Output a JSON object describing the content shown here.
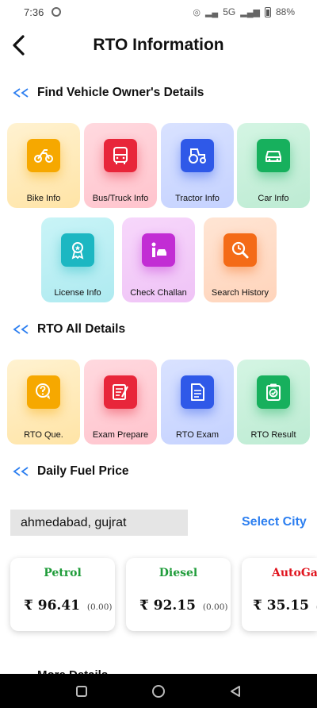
{
  "status_bar": {
    "time": "7:36",
    "network": "5G",
    "battery": "88%"
  },
  "header": {
    "title": "RTO Information"
  },
  "sections": {
    "owner": {
      "title": "Find Vehicle Owner's Details",
      "tiles": [
        {
          "label": "Bike Info",
          "icon": "motorbike-icon",
          "color": "#f6a800"
        },
        {
          "label": "Bus/Truck Info",
          "icon": "bus-icon",
          "color": "#e8263a"
        },
        {
          "label": "Tractor Info",
          "icon": "tractor-icon",
          "color": "#2f59e8"
        },
        {
          "label": "Car Info",
          "icon": "car-icon",
          "color": "#17b05d"
        },
        {
          "label": "License Info",
          "icon": "license-badge-icon",
          "color": "#1cb7c2"
        },
        {
          "label": "Check Challan",
          "icon": "challan-icon",
          "color": "#c22dd4"
        },
        {
          "label": "Search History",
          "icon": "search-history-icon",
          "color": "#f46b17"
        }
      ]
    },
    "rto": {
      "title": "RTO All Details",
      "tiles": [
        {
          "label": "RTO Que.",
          "icon": "question-chat-icon",
          "color": "#f6a800"
        },
        {
          "label": "Exam Prepare",
          "icon": "exam-document-icon",
          "color": "#e8263a"
        },
        {
          "label": "RTO Exam",
          "icon": "exam-sheet-icon",
          "color": "#2f59e8"
        },
        {
          "label": "RTO Result",
          "icon": "result-clipboard-icon",
          "color": "#17b05d"
        }
      ]
    },
    "fuel": {
      "title": "Daily Fuel Price",
      "city": "ahmedabad, gujrat",
      "select_city": "Select City",
      "cards": [
        {
          "name": "Petrol",
          "price": "₹ 96.41",
          "change": "(0.00)",
          "color": "#1f9c3a"
        },
        {
          "name": "Diesel",
          "price": "₹ 92.15",
          "change": "(0.00)",
          "color": "#1f9c3a"
        },
        {
          "name": "AutoGa",
          "price": "₹ 35.15",
          "change": "(-",
          "color": "#e0141e"
        }
      ]
    }
  },
  "bottom_peek": "More Details"
}
